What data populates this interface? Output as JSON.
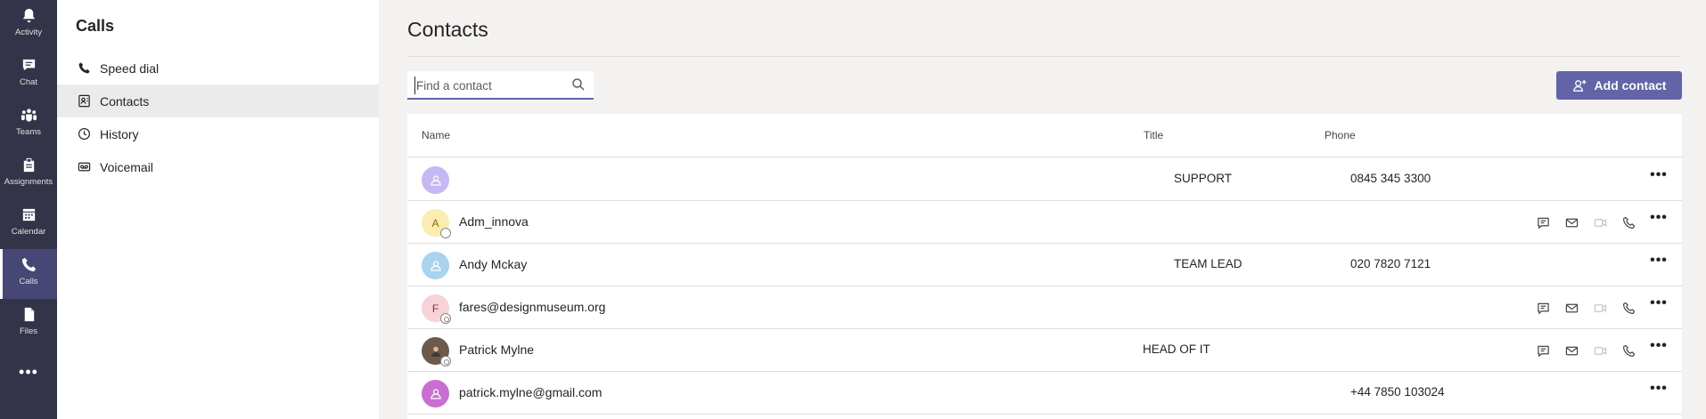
{
  "rail": {
    "items": [
      {
        "label": "Activity",
        "icon": "bell-icon"
      },
      {
        "label": "Chat",
        "icon": "chat-icon"
      },
      {
        "label": "Teams",
        "icon": "teams-icon"
      },
      {
        "label": "Assignments",
        "icon": "assignments-icon"
      },
      {
        "label": "Calendar",
        "icon": "calendar-icon"
      },
      {
        "label": "Calls",
        "icon": "phone-icon",
        "active": true
      },
      {
        "label": "Files",
        "icon": "file-icon"
      }
    ],
    "more": "•••"
  },
  "panel": {
    "title": "Calls",
    "items": [
      {
        "label": "Speed dial",
        "icon": "phone-icon"
      },
      {
        "label": "Contacts",
        "icon": "contact-card-icon",
        "active": true
      },
      {
        "label": "History",
        "icon": "clock-icon"
      },
      {
        "label": "Voicemail",
        "icon": "voicemail-icon"
      }
    ]
  },
  "main": {
    "title": "Contacts",
    "search": {
      "placeholder": "Find a contact",
      "value": ""
    },
    "add_contact_label": "Add contact",
    "columns": {
      "name": "Name",
      "title": "Title",
      "phone": "Phone"
    },
    "rows": [
      {
        "initial": "",
        "name": "",
        "title": "SUPPORT",
        "phone": "0845 345 3300",
        "avatar_color": "#c5b8f3"
      },
      {
        "initial": "A",
        "name": "Adm_innova",
        "title": "",
        "phone": "",
        "avatar_color": "#fbecb1"
      },
      {
        "initial": "",
        "name": "Andy Mckay",
        "title": "TEAM LEAD",
        "phone": "020 7820 7121",
        "avatar_color": "#a9d3ef"
      },
      {
        "initial": "F",
        "name": "fares@designmuseum.org",
        "title": "",
        "phone": "",
        "avatar_color": "#f6d3d6"
      },
      {
        "initial": "",
        "name": "Patrick Mylne",
        "title": "HEAD OF IT",
        "phone": "",
        "avatar_color": "#6e5a4a"
      },
      {
        "initial": "",
        "name": "patrick.mylne@gmail.com",
        "title": "",
        "phone": "+44 7850 103024",
        "avatar_color": "#c86fcf"
      }
    ],
    "row_more": "•••"
  },
  "colors": {
    "rail_bg": "#33344a",
    "accent": "#6264a7",
    "active_rail": "#464775"
  }
}
